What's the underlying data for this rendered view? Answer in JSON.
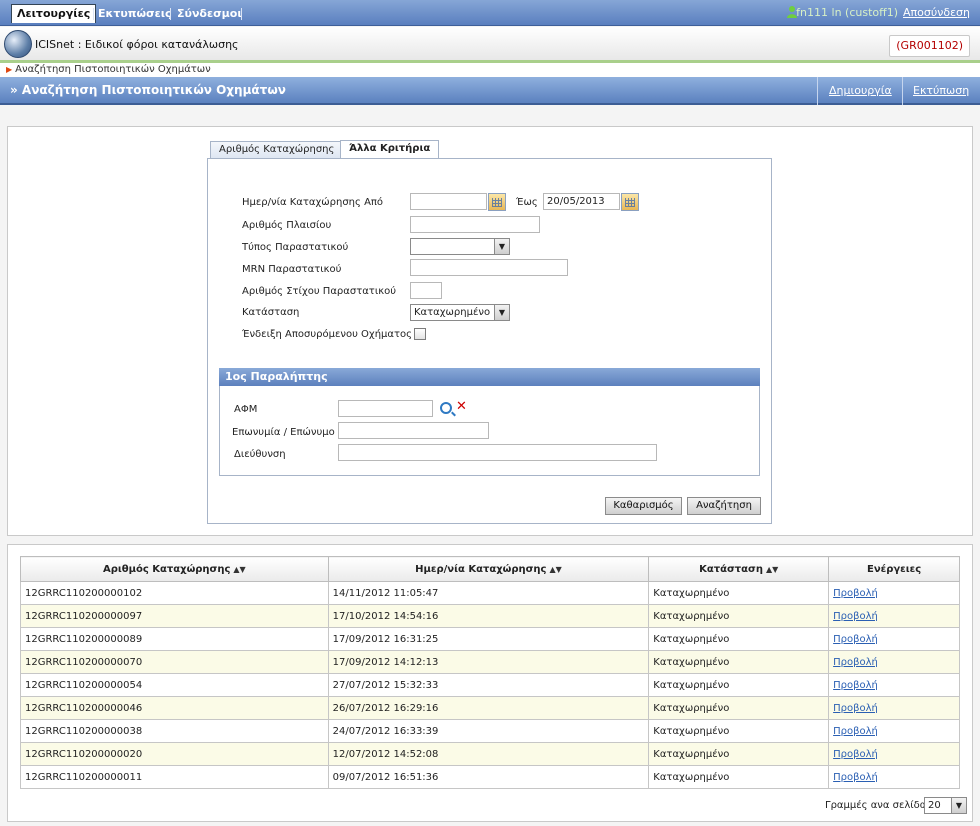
{
  "topbar": {
    "menu": [
      "Λειτουργίες",
      "Εκτυπώσεις",
      "Σύνδεσμοι"
    ],
    "user": "fn111 ln (custoff1)",
    "logout": "Αποσύνδεση"
  },
  "app": {
    "title": "ICISnet : Ειδικοί φόροι κατανάλωσης",
    "org_code": "(GR001102)"
  },
  "breadcrumb": "Αναζήτηση Πιστοποιητικών Οχημάτων",
  "section": {
    "title": "» Αναζήτηση Πιστοποιητικών Οχημάτων",
    "create": "Δημιουργία",
    "print": "Εκτύπωση"
  },
  "tabs": [
    "Αριθμός Καταχώρησης",
    "Άλλα Κριτήρια"
  ],
  "form": {
    "date_from_label": "Ημερ/νία Καταχώρησης Από",
    "date_from_value": "",
    "date_to_label": "Έως",
    "date_to_value": "20/05/2013",
    "frame_label": "Αριθμός Πλαισίου",
    "doc_type_label": "Τύπος Παραστατικού",
    "doc_type_value": "",
    "mrn_label": "MRN Παραστατικού",
    "line_label": "Αριθμός Στίχου Παραστατικού",
    "status_label": "Κατάσταση",
    "status_value": "Καταχωρημένο",
    "withdrawn_label": "Ένδειξη Αποσυρόμενου Οχήματος"
  },
  "receiver": {
    "title": "1ος Παραλήπτης",
    "afm_label": "ΑΦΜ",
    "name_label": "Επωνυμία / Επώνυμο",
    "address_label": "Διεύθυνση"
  },
  "buttons": {
    "clear": "Καθαρισμός",
    "search": "Αναζήτηση"
  },
  "table": {
    "headers": [
      "Αριθμός Καταχώρησης",
      "Ημερ/νία Καταχώρησης",
      "Κατάσταση",
      "Ενέργειες"
    ],
    "rows": [
      {
        "id": "12GRRC110200000102",
        "date": "14/11/2012 11:05:47",
        "status": "Καταχωρημένο",
        "action": "Προβολή"
      },
      {
        "id": "12GRRC110200000097",
        "date": "17/10/2012 14:54:16",
        "status": "Καταχωρημένο",
        "action": "Προβολή"
      },
      {
        "id": "12GRRC110200000089",
        "date": "17/09/2012 16:31:25",
        "status": "Καταχωρημένο",
        "action": "Προβολή"
      },
      {
        "id": "12GRRC110200000070",
        "date": "17/09/2012 14:12:13",
        "status": "Καταχωρημένο",
        "action": "Προβολή"
      },
      {
        "id": "12GRRC110200000054",
        "date": "27/07/2012 15:32:33",
        "status": "Καταχωρημένο",
        "action": "Προβολή"
      },
      {
        "id": "12GRRC110200000046",
        "date": "26/07/2012 16:29:16",
        "status": "Καταχωρημένο",
        "action": "Προβολή"
      },
      {
        "id": "12GRRC110200000038",
        "date": "24/07/2012 16:33:39",
        "status": "Καταχωρημένο",
        "action": "Προβολή"
      },
      {
        "id": "12GRRC110200000020",
        "date": "12/07/2012 14:52:08",
        "status": "Καταχωρημένο",
        "action": "Προβολή"
      },
      {
        "id": "12GRRC110200000011",
        "date": "09/07/2012 16:51:36",
        "status": "Καταχωρημένο",
        "action": "Προβολή"
      }
    ]
  },
  "pager": {
    "rows_label": "Γραμμές ανα σελίδα:",
    "rows_value": "20"
  }
}
